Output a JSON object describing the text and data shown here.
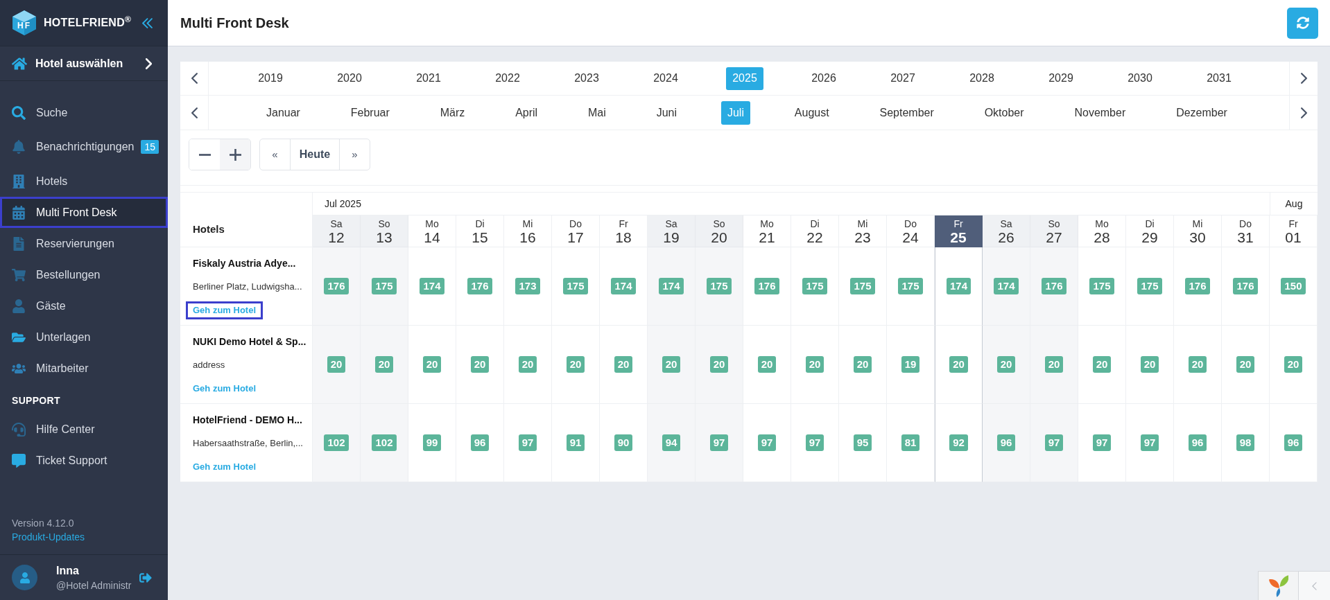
{
  "sidebar": {
    "logo": {
      "mark": "HF",
      "name": "HOTELFRIEND$^{®}$"
    },
    "hotel_selector": {
      "label": "Hotel auswählen"
    },
    "items": [
      {
        "label": "Suche",
        "selected": false
      },
      {
        "label": "Benachrichtigungen",
        "badge": "15",
        "selected": false
      },
      {
        "label": "Hotels",
        "selected": false
      },
      {
        "label": "Multi Front Desk",
        "selected": true
      },
      {
        "label": "Reservierungen",
        "selected": false
      },
      {
        "label": "Bestellungen",
        "selected": false
      },
      {
        "label": "Gäste",
        "selected": false
      },
      {
        "label": "Unterlagen",
        "selected": false
      },
      {
        "label": "Mitarbeiter",
        "selected": false
      }
    ],
    "support": {
      "heading": "SUPPORT",
      "items": [
        {
          "label": "Hilfe Center",
          "selected": false
        },
        {
          "label": "Ticket Support",
          "selected": false
        }
      ]
    },
    "version": "Version 4.12.0",
    "updates_link": "Produkt-Updates",
    "user": {
      "name": "Inna",
      "role": "@Hotel Administr"
    }
  },
  "header": {
    "title": "Multi Front Desk"
  },
  "calendar": {
    "years": [
      {
        "label": "2019",
        "selected": false
      },
      {
        "label": "2020",
        "selected": false
      },
      {
        "label": "2021",
        "selected": false
      },
      {
        "label": "2022",
        "selected": false
      },
      {
        "label": "2023",
        "selected": false
      },
      {
        "label": "2024",
        "selected": false
      },
      {
        "label": "2025",
        "selected": true
      },
      {
        "label": "2026",
        "selected": false
      },
      {
        "label": "2027",
        "selected": false
      },
      {
        "label": "2028",
        "selected": false
      },
      {
        "label": "2029",
        "selected": false
      },
      {
        "label": "2030",
        "selected": false
      },
      {
        "label": "2031",
        "selected": false
      }
    ],
    "months": [
      {
        "label": "Januar",
        "selected": false
      },
      {
        "label": "Februar",
        "selected": false
      },
      {
        "label": "März",
        "selected": false
      },
      {
        "label": "April",
        "selected": false
      },
      {
        "label": "Mai",
        "selected": false
      },
      {
        "label": "Juni",
        "selected": false
      },
      {
        "label": "Juli",
        "selected": true
      },
      {
        "label": "August",
        "selected": false
      },
      {
        "label": "September",
        "selected": false
      },
      {
        "label": "Oktober",
        "selected": false
      },
      {
        "label": "November",
        "selected": false
      },
      {
        "label": "Dezember",
        "selected": false
      }
    ],
    "controls": {
      "previous": "«",
      "today": "Heute",
      "next": "»"
    }
  },
  "grid": {
    "hotels_heading": "Hotels",
    "months": [
      {
        "label": "Jul 2025",
        "days": [
          {
            "weekday": "Sa",
            "day": "12",
            "weekend": true,
            "today": false
          },
          {
            "weekday": "So",
            "day": "13",
            "weekend": true,
            "today": false
          },
          {
            "weekday": "Mo",
            "day": "14",
            "weekend": false,
            "today": false
          },
          {
            "weekday": "Di",
            "day": "15",
            "weekend": false,
            "today": false
          },
          {
            "weekday": "Mi",
            "day": "16",
            "weekend": false,
            "today": false
          },
          {
            "weekday": "Do",
            "day": "17",
            "weekend": false,
            "today": false
          },
          {
            "weekday": "Fr",
            "day": "18",
            "weekend": false,
            "today": false
          },
          {
            "weekday": "Sa",
            "day": "19",
            "weekend": true,
            "today": false
          },
          {
            "weekday": "So",
            "day": "20",
            "weekend": true,
            "today": false
          },
          {
            "weekday": "Mo",
            "day": "21",
            "weekend": false,
            "today": false
          },
          {
            "weekday": "Di",
            "day": "22",
            "weekend": false,
            "today": false
          },
          {
            "weekday": "Mi",
            "day": "23",
            "weekend": false,
            "today": false
          },
          {
            "weekday": "Do",
            "day": "24",
            "weekend": false,
            "today": false
          },
          {
            "weekday": "Fr",
            "day": "25",
            "weekend": false,
            "today": true
          },
          {
            "weekday": "Sa",
            "day": "26",
            "weekend": true,
            "today": false
          },
          {
            "weekday": "So",
            "day": "27",
            "weekend": true,
            "today": false
          },
          {
            "weekday": "Mo",
            "day": "28",
            "weekend": false,
            "today": false
          },
          {
            "weekday": "Di",
            "day": "29",
            "weekend": false,
            "today": false
          },
          {
            "weekday": "Mi",
            "day": "30",
            "weekend": false,
            "today": false
          },
          {
            "weekday": "Do",
            "day": "31",
            "weekend": false,
            "today": false
          }
        ]
      },
      {
        "label": "Aug",
        "days": [
          {
            "weekday": "Fr",
            "day": "01",
            "weekend": false,
            "today": false
          }
        ]
      }
    ],
    "hotels": [
      {
        "name": "Fiskaly Austria Adye...",
        "address": "Berliner Platz, Ludwigsha...",
        "link": "Geh zum Hotel",
        "focused": true,
        "values": [
          "176",
          "175",
          "174",
          "176",
          "173",
          "175",
          "174",
          "174",
          "175",
          "176",
          "175",
          "175",
          "175",
          "174",
          "174",
          "176",
          "175",
          "175",
          "176",
          "176",
          "150"
        ]
      },
      {
        "name": "NUKI Demo Hotel & Sp...",
        "address": "address",
        "link": "Geh zum Hotel",
        "focused": false,
        "values": [
          "20",
          "20",
          "20",
          "20",
          "20",
          "20",
          "20",
          "20",
          "20",
          "20",
          "20",
          "20",
          "19",
          "20",
          "20",
          "20",
          "20",
          "20",
          "20",
          "20",
          "20"
        ]
      },
      {
        "name": "HotelFriend - DEMO H...",
        "address": "Habersaathstraße, Berlin,...",
        "link": "Geh zum Hotel",
        "focused": false,
        "values": [
          "102",
          "102",
          "99",
          "96",
          "97",
          "91",
          "90",
          "94",
          "97",
          "97",
          "97",
          "95",
          "81",
          "92",
          "96",
          "97",
          "97",
          "97",
          "96",
          "98",
          "96"
        ]
      }
    ]
  }
}
